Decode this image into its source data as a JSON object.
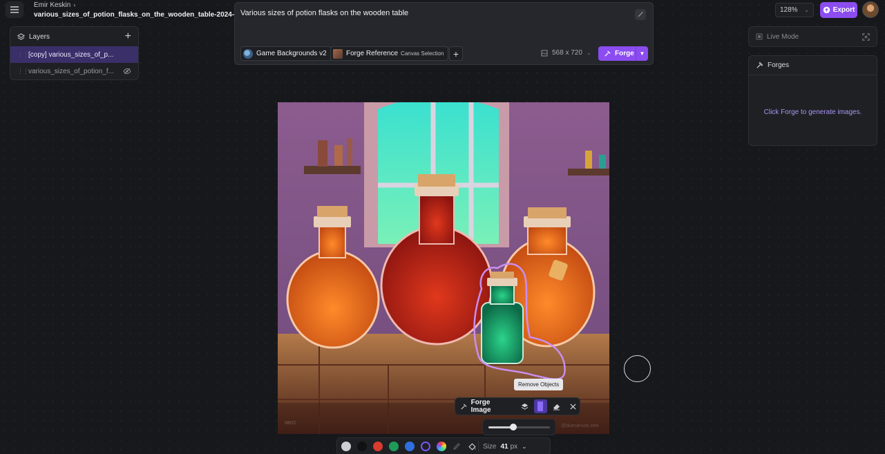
{
  "header": {
    "user_name": "Emir Keskin",
    "project_name": "various_sizes_of_potion_flasks_on_the_wooden_table-2024-04-0"
  },
  "layers": {
    "title": "Layers",
    "items": [
      {
        "name": "[copy] various_sizes_of_p...",
        "active": true
      },
      {
        "name": "various_sizes_of_potion_f...",
        "hidden": true
      }
    ]
  },
  "prompt": {
    "text": "Various sizes of potion flasks on the wooden table",
    "models": [
      {
        "label": "Game Backgrounds v2"
      },
      {
        "label": "Forge Reference",
        "sublabel": "Canvas Selection"
      }
    ],
    "size": "568 x 720",
    "forge_label": "Forge"
  },
  "topbar": {
    "zoom": "128%",
    "export_label": "Export"
  },
  "right_panel": {
    "live_mode_label": "Live Mode",
    "forges_title": "Forges",
    "forges_empty": "Click Forge to generate images."
  },
  "canvas": {
    "watermark_left": "MKO",
    "watermark_right": "@duecanvas.eee"
  },
  "toolbar": {
    "tooltip": "Remove Objects",
    "forge_image_label": "Forge Image",
    "slider_fraction": 0.4
  },
  "palette": {
    "colors": [
      "#cfcfd2",
      "#111111",
      "#d93b2f",
      "#1f9a58",
      "#2f6fe0"
    ],
    "size_label": "Size",
    "size_value": "41",
    "size_unit": "px"
  }
}
